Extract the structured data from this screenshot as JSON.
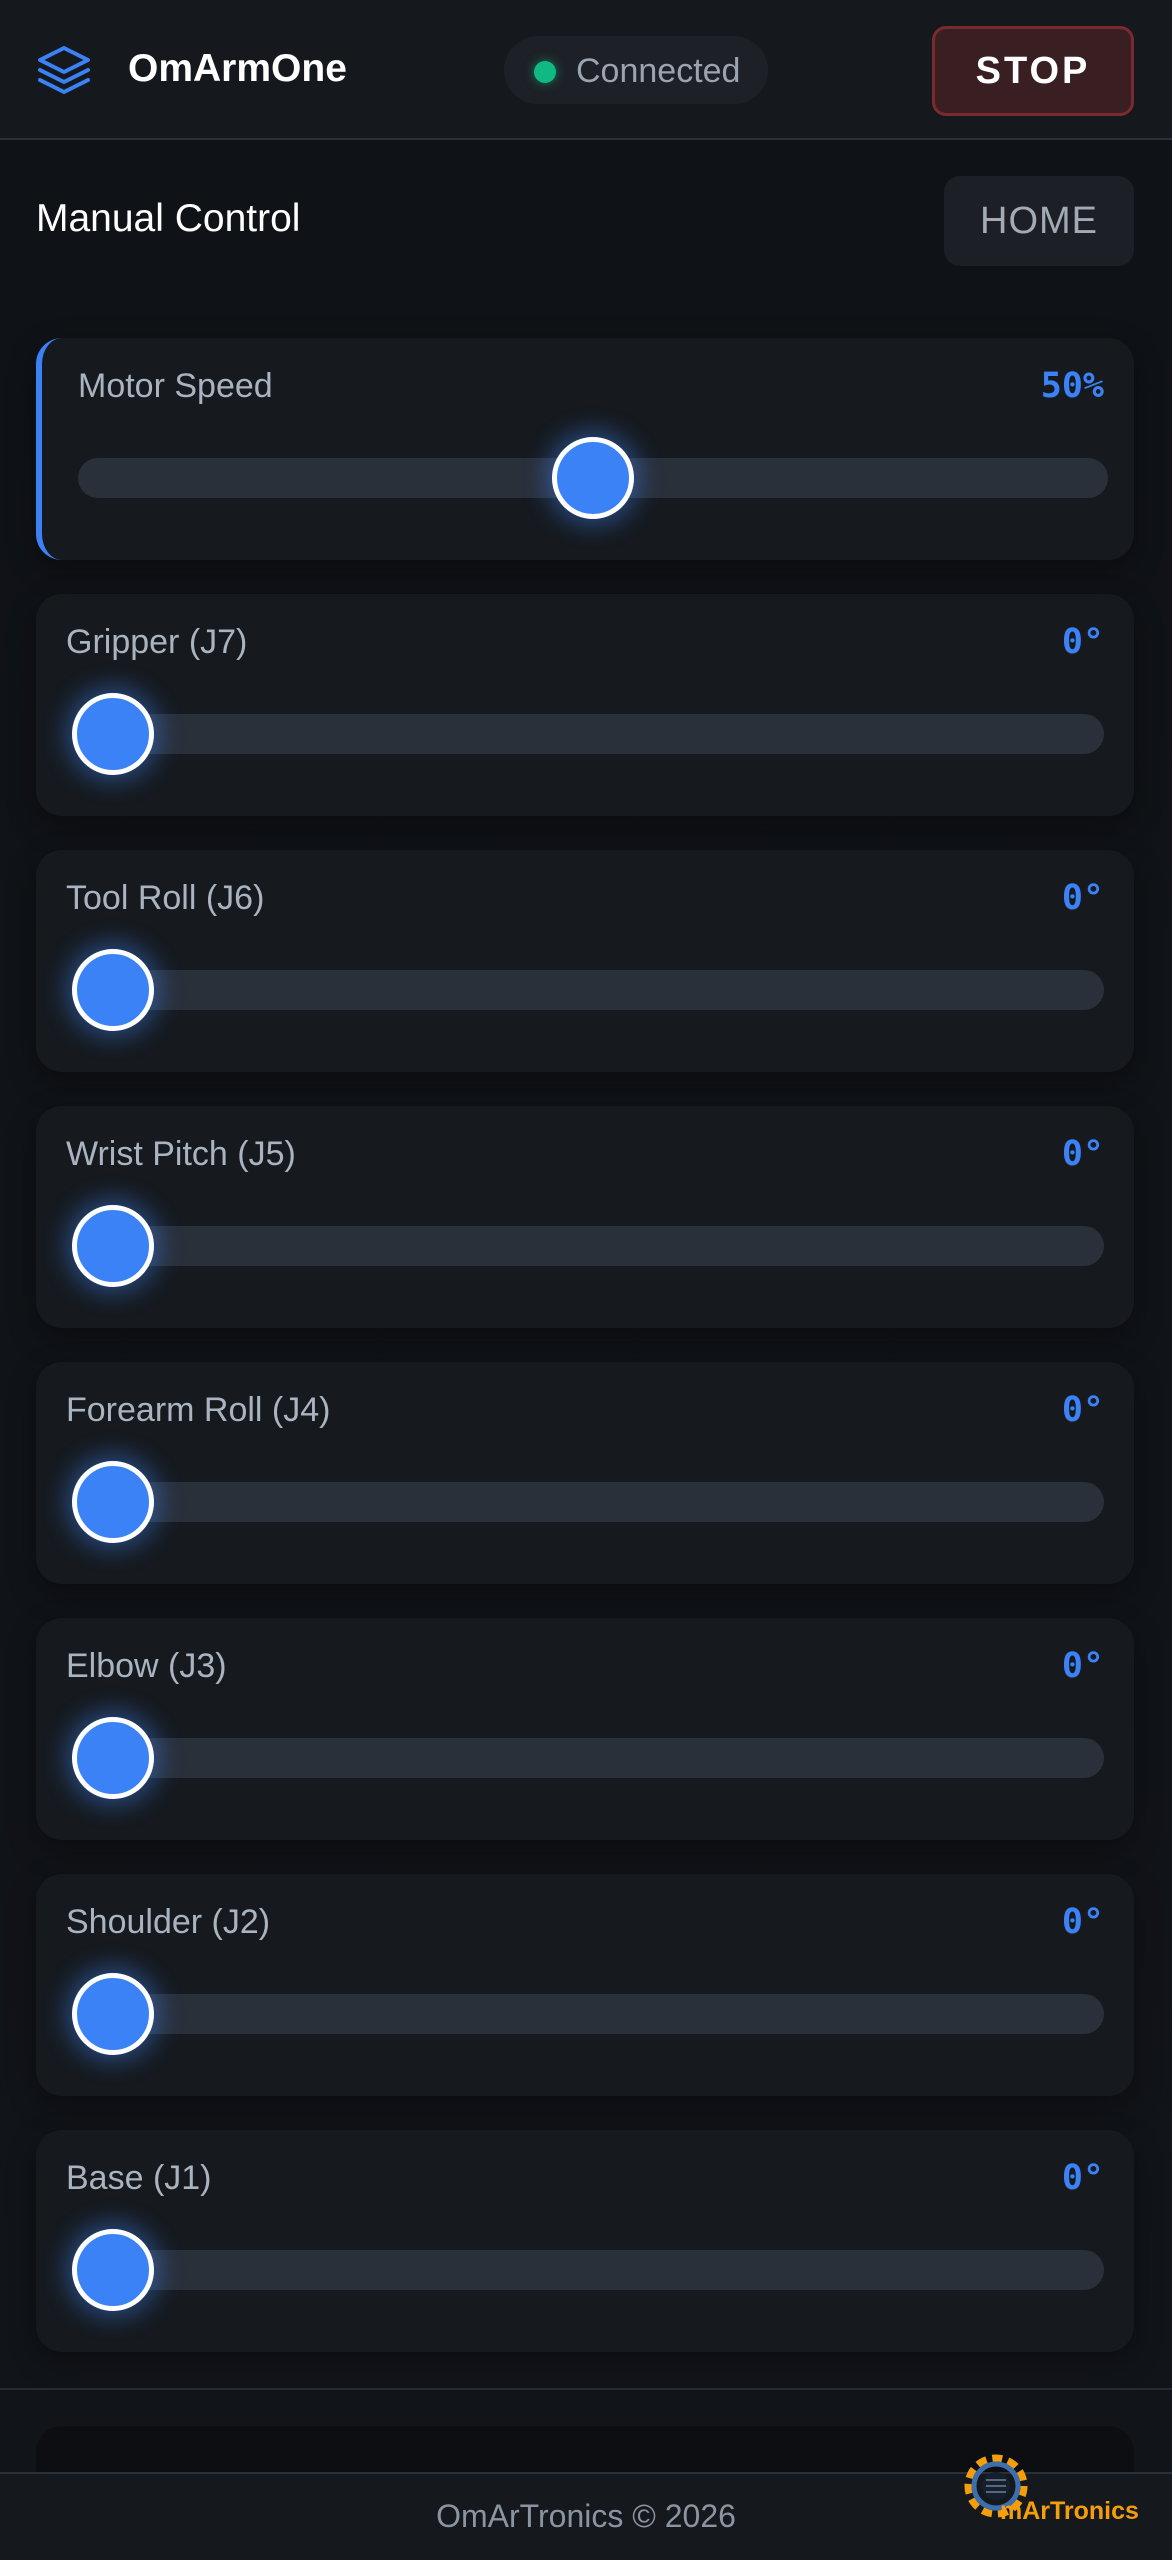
{
  "header": {
    "app_title": "OmArmOne",
    "logo_icon": "layers-icon",
    "status": {
      "label": "Connected",
      "color": "#10b981"
    },
    "stop_label": "STOP"
  },
  "section": {
    "title": "Manual Control",
    "home_label": "HOME"
  },
  "controls": [
    {
      "label": "Motor Speed",
      "value": "50%",
      "fraction": 0.5
    },
    {
      "label": "Gripper (J7)",
      "value": "0°",
      "fraction": 0
    },
    {
      "label": "Tool Roll (J6)",
      "value": "0°",
      "fraction": 0
    },
    {
      "label": "Wrist Pitch (J5)",
      "value": "0°",
      "fraction": 0
    },
    {
      "label": "Forearm Roll (J4)",
      "value": "0°",
      "fraction": 0
    },
    {
      "label": "Elbow (J3)",
      "value": "0°",
      "fraction": 0
    },
    {
      "label": "Shoulder (J2)",
      "value": "0°",
      "fraction": 0
    },
    {
      "label": "Base (J1)",
      "value": "0°",
      "fraction": 0
    }
  ],
  "footer": {
    "copyright": "OmArTronics © 2026",
    "brand_text": "mArTronics"
  },
  "colors": {
    "accent": "#3b82f6",
    "stop": "#7a2b30",
    "background": "#0f1216"
  }
}
